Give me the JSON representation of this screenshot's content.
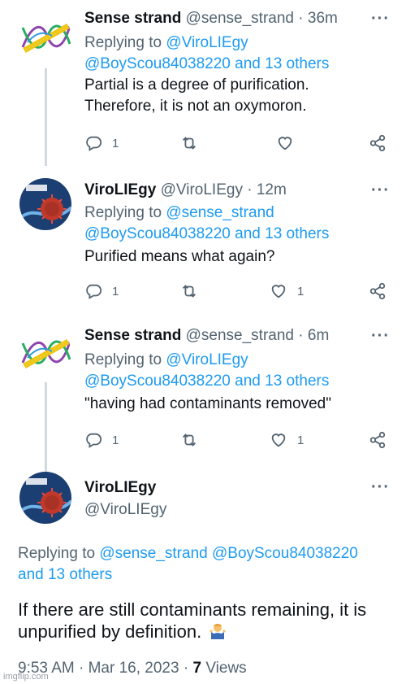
{
  "tweets": [
    {
      "name": "Sense strand",
      "handle": "@sense_strand",
      "time": "36m",
      "replying_label": "Replying to",
      "replying_to_1": "@ViroLIEgy",
      "replying_to_2": "@BoyScou84038220 and 13 others",
      "text_line1": "Partial is a degree of purification.",
      "text_line2": "Therefore, it is not an oxymoron.",
      "replies": "1",
      "retweets": "",
      "likes": ""
    },
    {
      "name": "ViroLIEgy",
      "handle": "@ViroLIEgy",
      "time": "12m",
      "replying_label": "Replying to",
      "replying_to_1": "@sense_strand",
      "replying_to_2": "@BoyScou84038220 and 13 others",
      "text_line1": "Purified means what again?",
      "replies": "1",
      "retweets": "",
      "likes": "1"
    },
    {
      "name": "Sense strand",
      "handle": "@sense_strand",
      "time": "6m",
      "replying_label": "Replying to",
      "replying_to_1": "@ViroLIEgy",
      "replying_to_2": "@BoyScou84038220 and 13 others",
      "text_line1": "\"having had contaminants removed\"",
      "replies": "1",
      "retweets": "",
      "likes": "1"
    }
  ],
  "main": {
    "name": "ViroLIEgy",
    "handle": "@ViroLIEgy",
    "replying_label": "Replying to",
    "replying_to_1": "@sense_strand @BoyScou84038220",
    "replying_to_2": "and 13 others",
    "text_line1": "If there are still contaminants remaining, it is",
    "text_line2": "unpurified by definition.",
    "emoji": "person-shrugging-emoji",
    "time": "9:53 AM",
    "date": "Mar 16, 2023",
    "views_count": "7",
    "views_label": "Views"
  },
  "separator": "·",
  "more_glyph": "···",
  "watermark": "imgflip.com",
  "colors": {
    "link": "#1d9bf0",
    "secondary": "#536471",
    "primary": "#0f1419",
    "thread_line": "#cfd9de"
  },
  "icons": [
    "reply-icon",
    "retweet-icon",
    "like-icon",
    "share-icon"
  ]
}
